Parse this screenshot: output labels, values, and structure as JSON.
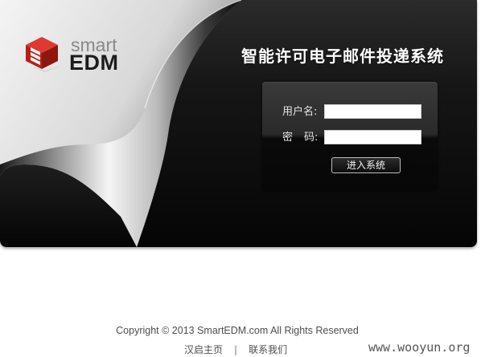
{
  "brand": {
    "logo_top": "smart",
    "logo_bottom": "EDM",
    "logo_colors": {
      "red": "#d6281f",
      "dark_red": "#9e1812",
      "grey": "#8a8a8a",
      "black": "#1c1c1c"
    }
  },
  "header": {
    "system_title": "智能许可电子邮件投递系统"
  },
  "login": {
    "username_label": "用户名:",
    "password_label_1": "密",
    "password_label_2": "码:",
    "username_value": "",
    "password_value": "",
    "submit_label": "进入系统"
  },
  "footer": {
    "copyright": "Copyright © 2013 SmartEDM.com All Rights Reserved",
    "links": [
      "汉启主页",
      "联系我们"
    ],
    "separator": "|"
  },
  "watermark": "www.wooyun.org",
  "colors": {
    "banner_dark": "#0d0d0d",
    "panel_top": "#3a3a3a",
    "panel_bottom": "#070707",
    "text_footer": "#4d4d4d"
  }
}
